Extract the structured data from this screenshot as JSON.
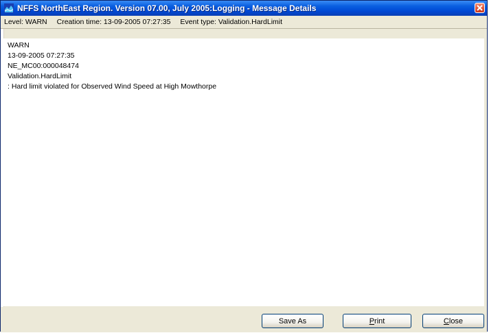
{
  "window": {
    "title": "NFFS NorthEast Region. Version 07.00, July 2005:Logging  - Message Details"
  },
  "infobar": {
    "level": "Level: WARN",
    "creation_time": "Creation time: 13-09-2005 07:27:35",
    "event_type": "Event type: Validation.HardLimit"
  },
  "message": {
    "lines": [
      "WARN",
      "13-09-2005 07:27:35",
      "NE_MC00:000048474",
      "Validation.HardLimit",
      " : Hard limit violated for Observed Wind Speed at High Mowthorpe"
    ]
  },
  "buttons": {
    "save_as": "Save As",
    "print_first": "P",
    "print_rest": "rint",
    "close_first": "C",
    "close_rest": "lose"
  },
  "colors": {
    "titlebar": "#0a5fe0",
    "window_face": "#ece9d8",
    "close_button": "#e0583a"
  },
  "icons": {
    "app": "nffs-app-icon",
    "close": "close-icon"
  }
}
